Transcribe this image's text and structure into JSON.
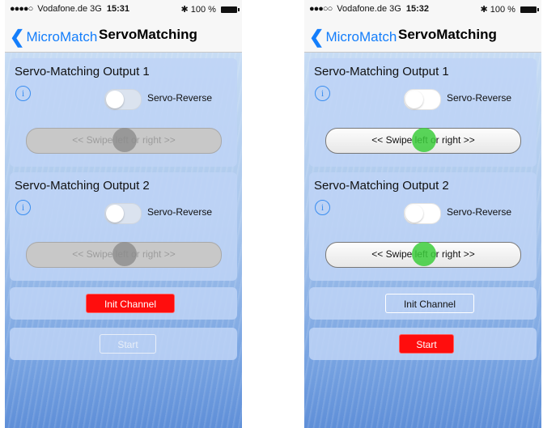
{
  "screens": [
    {
      "status": {
        "dots": "●●●●○",
        "carrier": "Vodafone.de",
        "network": "3G",
        "time": "15:31",
        "bluetooth": "✱",
        "battery": "100 %"
      },
      "nav": {
        "back_label": "MicroMatch",
        "title": "ServoMatching"
      },
      "outputs": [
        {
          "title": "Servo-Matching Output 1",
          "info": "i",
          "toggle_label": "Servo-Reverse",
          "swipe_text": "<< Swipe left or right >>"
        },
        {
          "title": "Servo-Matching Output 2",
          "info": "i",
          "toggle_label": "Servo-Reverse",
          "swipe_text": "<< Swipe left or right >>"
        }
      ],
      "init_button": "Init Channel",
      "start_button": "Start"
    },
    {
      "status": {
        "dots": "●●●○○",
        "carrier": "Vodafone.de",
        "network": "3G",
        "time": "15:32",
        "bluetooth": "✱",
        "battery": "100 %"
      },
      "nav": {
        "back_label": "MicroMatch",
        "title": "ServoMatching"
      },
      "outputs": [
        {
          "title": "Servo-Matching Output 1",
          "info": "i",
          "toggle_label": "Servo-Reverse",
          "swipe_text": "<< Swipe left or right >>"
        },
        {
          "title": "Servo-Matching Output 2",
          "info": "i",
          "toggle_label": "Servo-Reverse",
          "swipe_text": "<< Swipe left or right >>"
        }
      ],
      "init_button": "Init Channel",
      "start_button": "Start"
    }
  ],
  "colors": {
    "accent": "#147efb",
    "red_button": "#ff0d0d",
    "swipe_knob_active": "#3ccd3c",
    "swipe_knob_disabled": "#8c8c8c"
  },
  "icons": {
    "back": "chevron-left-icon",
    "info": "info-circle-icon",
    "bluetooth": "bluetooth-icon",
    "battery": "battery-icon"
  }
}
